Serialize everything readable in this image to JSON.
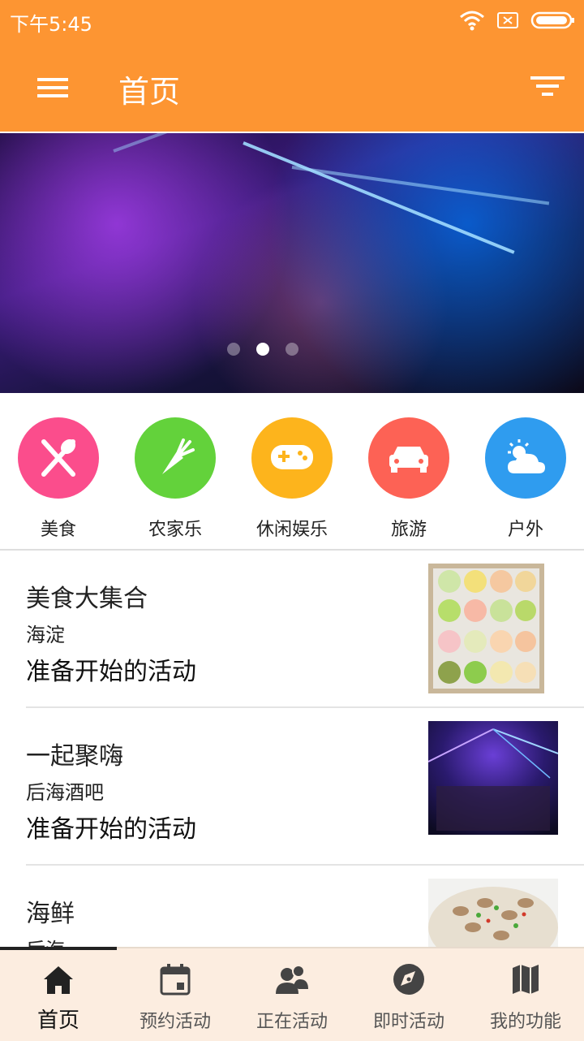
{
  "status_bar": {
    "time": "下午5:45"
  },
  "app_bar": {
    "title": "首页"
  },
  "banner": {
    "pages": 3,
    "active_page": 2
  },
  "categories": [
    {
      "label": "美食",
      "icon": "utensils-icon",
      "color": "#fb4d8c"
    },
    {
      "label": "农家乐",
      "icon": "carrot-icon",
      "color": "#63d23b"
    },
    {
      "label": "休闲娱乐",
      "icon": "gamepad-icon",
      "color": "#fdb41c"
    },
    {
      "label": "旅游",
      "icon": "car-icon",
      "color": "#fd6255"
    },
    {
      "label": "户外",
      "icon": "partly-cloudy-icon",
      "color": "#2f9cef"
    }
  ],
  "activities": [
    {
      "title": "美食大集合",
      "place": "海淀",
      "status": "准备开始的活动"
    },
    {
      "title": "一起聚嗨",
      "place": "后海酒吧",
      "status": "准备开始的活动"
    },
    {
      "title": "海鲜",
      "place": "后海",
      "status": ""
    }
  ],
  "bottom_nav": [
    {
      "label": "首页",
      "icon": "home-icon",
      "active": true
    },
    {
      "label": "预约活动",
      "icon": "calendar-icon",
      "active": false
    },
    {
      "label": "正在活动",
      "icon": "people-icon",
      "active": false
    },
    {
      "label": "即时活动",
      "icon": "compass-icon",
      "active": false
    },
    {
      "label": "我的功能",
      "icon": "map-icon",
      "active": false
    }
  ],
  "colors": {
    "primary": "#fd9532",
    "nav_bg": "#fcede0"
  }
}
